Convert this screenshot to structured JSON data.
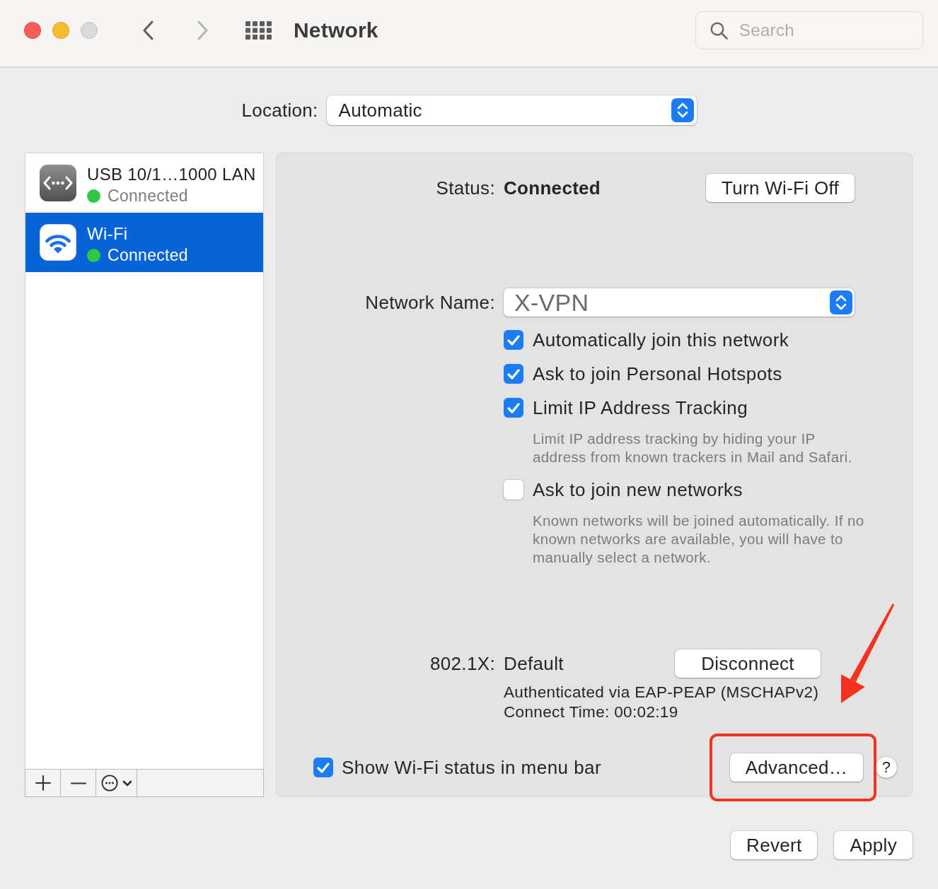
{
  "window": {
    "title": "Network",
    "controls": [
      {
        "kind": "close",
        "disabled": false
      },
      {
        "kind": "minimize",
        "disabled": false
      },
      {
        "kind": "zoom",
        "disabled": true
      }
    ],
    "navigation": [
      {
        "kind": "back",
        "disabled": false
      },
      {
        "kind": "forward",
        "disabled": true
      }
    ]
  },
  "search": {
    "placeholder": "Search"
  },
  "location": {
    "label": "Location:",
    "value": "Automatic"
  },
  "sidebar": {
    "items": [
      {
        "kind": "ethernet",
        "name": "USB 10/1…1000 LAN",
        "status": "Connected",
        "color": "#2ec845",
        "selected": false
      },
      {
        "kind": "wifi",
        "name": "Wi-Fi",
        "status": "Connected",
        "color": "#2ec845",
        "selected": true
      }
    ],
    "toolbar": [
      {
        "kind": "add"
      },
      {
        "kind": "remove"
      },
      {
        "kind": "actions"
      }
    ]
  },
  "panel": {
    "status": {
      "label": "Status:",
      "value": "Connected",
      "button": "Turn Wi-Fi Off"
    },
    "network_name": {
      "label": "Network Name:",
      "value": "X-VPN"
    },
    "options": [
      {
        "label": "Automatically join this network",
        "checked": true
      },
      {
        "label": "Ask to join Personal Hotspots",
        "checked": true
      },
      {
        "label": "Limit IP Address Tracking",
        "checked": true,
        "description": "Limit IP address tracking by hiding your IP address from known trackers in Mail and Safari."
      },
      {
        "label": "Ask to join new networks",
        "checked": false,
        "description": "Known networks will be joined automatically. If no known networks are available, you will have to manually select a network."
      }
    ],
    "auth": {
      "label": "802.1X:",
      "value": "Default",
      "button": "Disconnect",
      "details": [
        "Authenticated via EAP-PEAP (MSCHAPv2)",
        "Connect Time: 00:02:19"
      ]
    },
    "menu_bar_option": {
      "label": "Show Wi-Fi status in menu bar",
      "checked": true
    },
    "advanced_button": "Advanced…",
    "help_button": "?"
  },
  "buttons": [
    "Revert",
    "Apply"
  ],
  "annotations": [
    {
      "kind": "box"
    },
    {
      "kind": "arrow"
    }
  ]
}
